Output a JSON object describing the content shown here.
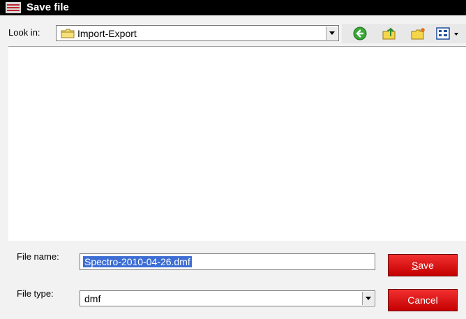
{
  "window": {
    "title": "Save file",
    "app_icon": "app-icon"
  },
  "toolbar": {
    "look_in_label": "Look in:",
    "look_in_value": "Import-Export",
    "folder_icon": "folder-icon",
    "back_icon": "back-icon",
    "up_folder_icon": "up-folder-icon",
    "new_folder_icon": "new-folder-icon",
    "view_menu_icon": "view-menu-icon"
  },
  "form": {
    "file_name_label": "File name:",
    "file_name_value": "Spectro-2010-04-26.dmf",
    "file_type_label": "File type:",
    "file_type_value": "dmf"
  },
  "buttons": {
    "save_prefix": "S",
    "save_rest": "ave",
    "cancel_label": "Cancel"
  },
  "colors": {
    "titlebar": "#000000",
    "button_red": "#e00000",
    "selection": "#3d6ed4"
  }
}
